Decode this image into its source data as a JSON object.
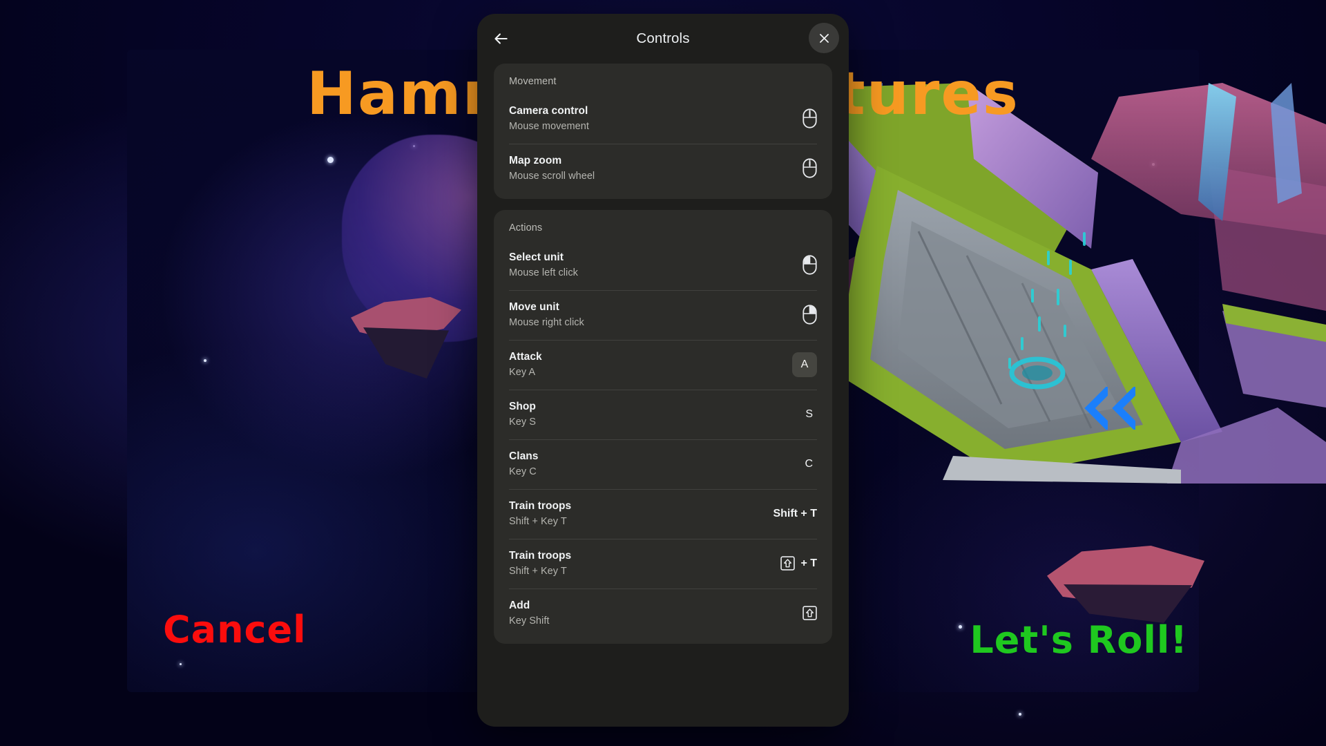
{
  "game": {
    "title": "Hammer Adventures",
    "title_color": "#f79a22",
    "cancel_label": "Cancel",
    "cancel_color": "#fb0d0d",
    "confirm_label": "Let's Roll!",
    "confirm_color": "#1fc81f",
    "chevron_icon": "double-chevron-right-icon",
    "chevron_color": "#1b7ffb"
  },
  "dialog": {
    "title": "Controls",
    "back_icon": "arrow-left-icon",
    "close_icon": "close-icon",
    "sections": [
      {
        "header": "Movement",
        "rows": [
          {
            "title": "Camera control",
            "subtitle": "Mouse movement",
            "binding_type": "icon",
            "icon": "mouse-icon",
            "binding_text": ""
          },
          {
            "title": "Map zoom",
            "subtitle": "Mouse scroll wheel",
            "binding_type": "icon",
            "icon": "mouse-scroll-icon",
            "binding_text": ""
          }
        ]
      },
      {
        "header": "Actions",
        "rows": [
          {
            "title": "Select unit",
            "subtitle": "Mouse left click",
            "binding_type": "icon",
            "icon": "mouse-left-click-icon",
            "binding_text": ""
          },
          {
            "title": "Move unit",
            "subtitle": "Mouse right click",
            "binding_type": "icon",
            "icon": "mouse-right-click-icon",
            "binding_text": ""
          },
          {
            "title": "Attack",
            "subtitle": "Key A",
            "binding_type": "badge",
            "icon": "",
            "binding_text": "A"
          },
          {
            "title": "Shop",
            "subtitle": "Key S",
            "binding_type": "plain",
            "icon": "",
            "binding_text": "S"
          },
          {
            "title": "Clans",
            "subtitle": "Key C",
            "binding_type": "plain",
            "icon": "",
            "binding_text": "C"
          },
          {
            "title": "Train troops",
            "subtitle": "Shift + Key T",
            "binding_type": "combo",
            "icon": "",
            "binding_text": "Shift + T"
          },
          {
            "title": "Train troops",
            "subtitle": "Shift + Key T",
            "binding_type": "shift-plus",
            "icon": "shift-key-icon",
            "binding_text": "+ T"
          },
          {
            "title": "Add",
            "subtitle": "Key Shift",
            "binding_type": "shift-only",
            "icon": "shift-key-icon",
            "binding_text": ""
          }
        ]
      }
    ]
  }
}
